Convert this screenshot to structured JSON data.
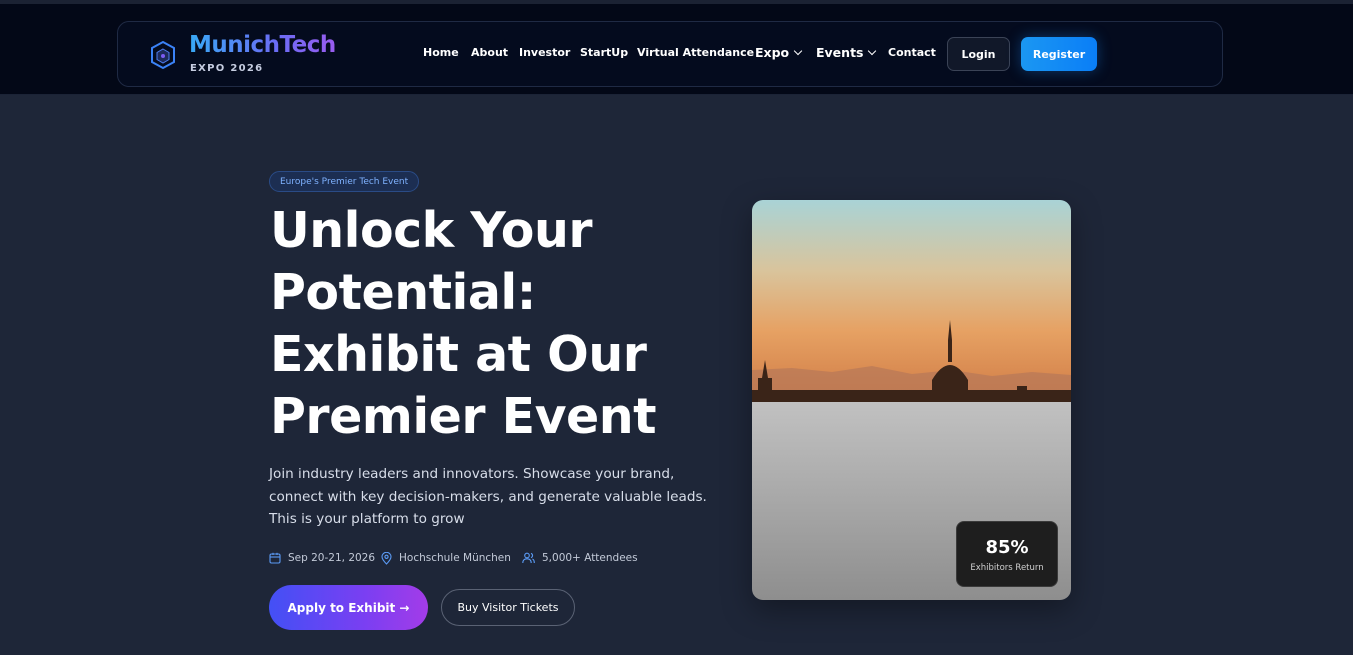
{
  "brand": {
    "name": "MunichTech",
    "subtitle": "EXPO 2026"
  },
  "nav": {
    "items": [
      {
        "label": "Home"
      },
      {
        "label": "About"
      },
      {
        "label": "Investor"
      },
      {
        "label": "StartUp"
      },
      {
        "label": "Virtual Attendance"
      },
      {
        "label": "Expo"
      },
      {
        "label": "Events"
      },
      {
        "label": "Contact"
      }
    ],
    "login_label": "Login",
    "register_label": "Register"
  },
  "hero": {
    "badge": "Europe's Premier Tech Event",
    "headline": "Unlock Your Potential: Exhibit at Our Premier Event",
    "description": "Join industry leaders and innovators. Showcase your brand, connect with key decision-makers, and generate valuable leads. This is your platform to grow",
    "date": "Sep 20-21, 2026",
    "location": "Hochschule München",
    "attendees": "5,000+ Attendees",
    "apply_label": "Apply to Exhibit →",
    "tickets_label": "Buy Visitor Tickets"
  },
  "stat": {
    "value": "85%",
    "label": "Exhibitors Return"
  },
  "colors": {
    "page_bg": "#1e2638",
    "nav_bg": "#030817",
    "accent_blue": "#0a7ef7",
    "accent_purple": "#7a3ff2",
    "badge_text": "#7fb2ff"
  },
  "icons": {
    "logo": "hexagon-icon",
    "date": "calendar-icon",
    "location": "map-pin-icon",
    "attendees": "users-icon"
  }
}
